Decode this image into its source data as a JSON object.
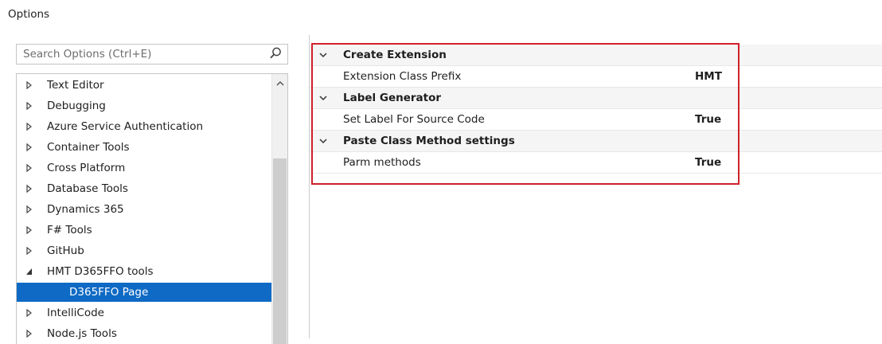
{
  "dialog": {
    "title": "Options"
  },
  "search": {
    "placeholder": "Search Options (Ctrl+E)"
  },
  "tree": {
    "items": [
      {
        "label": "Text Editor",
        "state": "collapsed"
      },
      {
        "label": "Debugging",
        "state": "collapsed"
      },
      {
        "label": "Azure Service Authentication",
        "state": "collapsed"
      },
      {
        "label": "Container Tools",
        "state": "collapsed"
      },
      {
        "label": "Cross Platform",
        "state": "collapsed"
      },
      {
        "label": "Database Tools",
        "state": "collapsed"
      },
      {
        "label": "Dynamics 365",
        "state": "collapsed"
      },
      {
        "label": "F# Tools",
        "state": "collapsed"
      },
      {
        "label": "GitHub",
        "state": "collapsed"
      },
      {
        "label": "HMT D365FFO tools",
        "state": "expanded"
      },
      {
        "label": "D365FFO Page",
        "state": "child-selected"
      },
      {
        "label": "IntelliCode",
        "state": "collapsed"
      },
      {
        "label": "Node.js Tools",
        "state": "collapsed"
      }
    ]
  },
  "properties": {
    "categories": [
      {
        "name": "Create Extension",
        "props": [
          {
            "name": "Extension Class Prefix",
            "value": "HMT"
          }
        ]
      },
      {
        "name": "Label Generator",
        "props": [
          {
            "name": "Set Label For Source Code",
            "value": "True"
          }
        ]
      },
      {
        "name": "Paste Class Method settings",
        "props": [
          {
            "name": "Parm methods",
            "value": "True"
          }
        ]
      }
    ]
  },
  "colors": {
    "selection": "#0e6ac4",
    "highlight_border": "#d0212a",
    "category_background": "#f5f5f5"
  }
}
